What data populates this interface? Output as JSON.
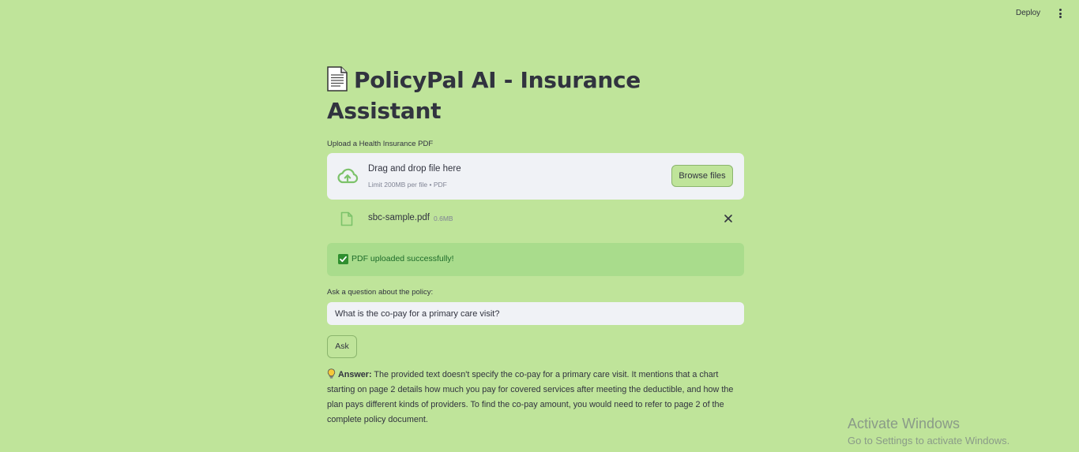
{
  "header": {
    "deploy_label": "Deploy",
    "menu_icon": "vertical-ellipsis-icon"
  },
  "page": {
    "title": "PolicyPal AI - Insurance Assistant",
    "title_icon": "page-document-icon"
  },
  "uploader": {
    "label": "Upload a Health Insurance PDF",
    "drop_text": "Drag and drop file here",
    "limit_text": "Limit 200MB per file • PDF",
    "browse_label": "Browse files",
    "icon": "cloud-upload-icon"
  },
  "uploaded_file": {
    "name": "sbc-sample.pdf",
    "size": "0.6MB",
    "icon": "file-icon",
    "remove_icon": "close-icon"
  },
  "status": {
    "message": "PDF uploaded successfully!",
    "icon": "check-mark-icon"
  },
  "question": {
    "label": "Ask a question about the policy:",
    "value": "What is the co-pay for a primary care visit?"
  },
  "ask_button": {
    "label": "Ask"
  },
  "answer": {
    "icon": "light-bulb-icon",
    "label": "Answer:",
    "text": "The provided text doesn't specify the co-pay for a primary care visit. It mentions that a chart starting on page 2 details how much you pay for covered services after meeting the deductible, and how the plan pays different kinds of providers. To find the co-pay amount, you would need to refer to page 2 of the complete policy document."
  },
  "watermark": {
    "title": "Activate Windows",
    "subtitle": "Go to Settings to activate Windows."
  },
  "colors": {
    "background": "#bfe49a",
    "text": "#31333f",
    "input_bg": "#f0f2f6",
    "success_bg": "#a9dc8c",
    "success_text": "#1d6b2a",
    "accent_green": "#7cc26a"
  }
}
